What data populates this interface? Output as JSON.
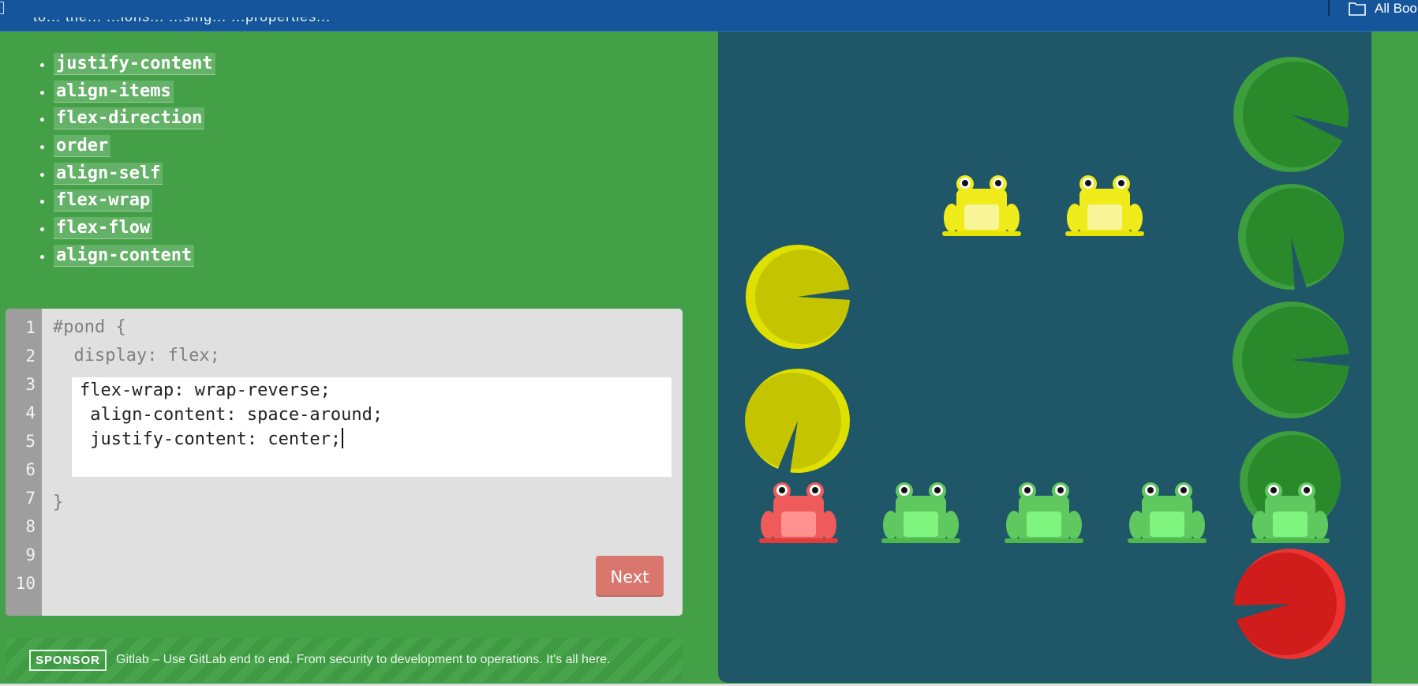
{
  "browser": {
    "bookmarks_label": "All Boo"
  },
  "instructions": {
    "cut_line": "to... the... ...ions... ...sing... ...properties...",
    "properties": [
      "justify-content",
      "align-items",
      "flex-direction",
      "order",
      "align-self",
      "flex-wrap",
      "flex-flow",
      "align-content"
    ]
  },
  "editor": {
    "line_numbers": [
      "1",
      "2",
      "3",
      "4",
      "5",
      "6",
      "7",
      "8",
      "9",
      "10"
    ],
    "line1": "#pond {",
    "line2": "  display: flex;",
    "input_lines": [
      "flex-wrap: wrap-reverse;",
      " align-content: space-around;",
      " justify-content: center;"
    ],
    "closing": "}",
    "next_label": "Next"
  },
  "sponsor": {
    "tag": "SPONSOR",
    "text": "Gitlab – Use GitLab end to end. From security to development to operations. It's all here."
  },
  "pond": {
    "lilypads": [
      {
        "color": "green"
      },
      {
        "color": "green"
      },
      {
        "color": "green"
      },
      {
        "color": "green"
      },
      {
        "color": "red"
      },
      {
        "color": "yellow"
      },
      {
        "color": "yellow"
      }
    ],
    "frogs": [
      {
        "color": "yellow"
      },
      {
        "color": "yellow"
      },
      {
        "color": "red"
      },
      {
        "color": "green"
      },
      {
        "color": "green"
      },
      {
        "color": "green"
      },
      {
        "color": "green"
      }
    ],
    "colors": {
      "green_pad": "#2a8a2b",
      "green_pad_rim": "#3d9e3d",
      "yellow_pad": "#c5c400",
      "yellow_pad_rim": "#dfe000",
      "red_pad": "#d11c1c",
      "red_pad_rim": "#ee3333",
      "green_frog": "#5fc95f",
      "yellow_frog": "#f0ec1c",
      "red_frog": "#ef5a5a"
    }
  }
}
